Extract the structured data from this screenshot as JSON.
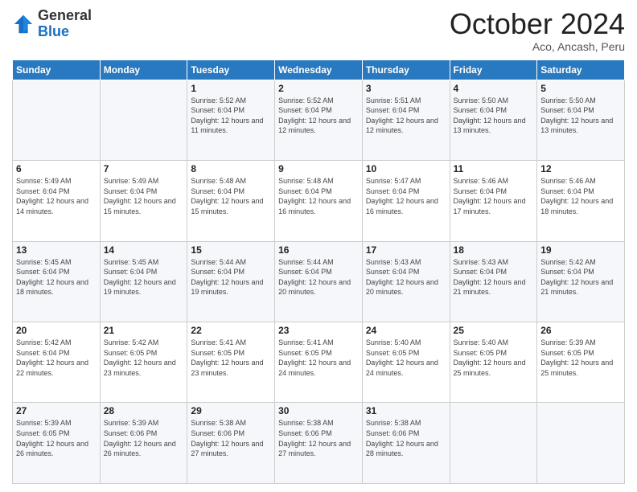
{
  "logo": {
    "general": "General",
    "blue": "Blue"
  },
  "header": {
    "month": "October 2024",
    "location": "Aco, Ancash, Peru"
  },
  "weekdays": [
    "Sunday",
    "Monday",
    "Tuesday",
    "Wednesday",
    "Thursday",
    "Friday",
    "Saturday"
  ],
  "weeks": [
    [
      null,
      null,
      {
        "day": 1,
        "sunrise": "5:52 AM",
        "sunset": "6:04 PM",
        "daylight": "12 hours and 11 minutes."
      },
      {
        "day": 2,
        "sunrise": "5:52 AM",
        "sunset": "6:04 PM",
        "daylight": "12 hours and 12 minutes."
      },
      {
        "day": 3,
        "sunrise": "5:51 AM",
        "sunset": "6:04 PM",
        "daylight": "12 hours and 12 minutes."
      },
      {
        "day": 4,
        "sunrise": "5:50 AM",
        "sunset": "6:04 PM",
        "daylight": "12 hours and 13 minutes."
      },
      {
        "day": 5,
        "sunrise": "5:50 AM",
        "sunset": "6:04 PM",
        "daylight": "12 hours and 13 minutes."
      }
    ],
    [
      {
        "day": 6,
        "sunrise": "5:49 AM",
        "sunset": "6:04 PM",
        "daylight": "12 hours and 14 minutes."
      },
      {
        "day": 7,
        "sunrise": "5:49 AM",
        "sunset": "6:04 PM",
        "daylight": "12 hours and 15 minutes."
      },
      {
        "day": 8,
        "sunrise": "5:48 AM",
        "sunset": "6:04 PM",
        "daylight": "12 hours and 15 minutes."
      },
      {
        "day": 9,
        "sunrise": "5:48 AM",
        "sunset": "6:04 PM",
        "daylight": "12 hours and 16 minutes."
      },
      {
        "day": 10,
        "sunrise": "5:47 AM",
        "sunset": "6:04 PM",
        "daylight": "12 hours and 16 minutes."
      },
      {
        "day": 11,
        "sunrise": "5:46 AM",
        "sunset": "6:04 PM",
        "daylight": "12 hours and 17 minutes."
      },
      {
        "day": 12,
        "sunrise": "5:46 AM",
        "sunset": "6:04 PM",
        "daylight": "12 hours and 18 minutes."
      }
    ],
    [
      {
        "day": 13,
        "sunrise": "5:45 AM",
        "sunset": "6:04 PM",
        "daylight": "12 hours and 18 minutes."
      },
      {
        "day": 14,
        "sunrise": "5:45 AM",
        "sunset": "6:04 PM",
        "daylight": "12 hours and 19 minutes."
      },
      {
        "day": 15,
        "sunrise": "5:44 AM",
        "sunset": "6:04 PM",
        "daylight": "12 hours and 19 minutes."
      },
      {
        "day": 16,
        "sunrise": "5:44 AM",
        "sunset": "6:04 PM",
        "daylight": "12 hours and 20 minutes."
      },
      {
        "day": 17,
        "sunrise": "5:43 AM",
        "sunset": "6:04 PM",
        "daylight": "12 hours and 20 minutes."
      },
      {
        "day": 18,
        "sunrise": "5:43 AM",
        "sunset": "6:04 PM",
        "daylight": "12 hours and 21 minutes."
      },
      {
        "day": 19,
        "sunrise": "5:42 AM",
        "sunset": "6:04 PM",
        "daylight": "12 hours and 21 minutes."
      }
    ],
    [
      {
        "day": 20,
        "sunrise": "5:42 AM",
        "sunset": "6:04 PM",
        "daylight": "12 hours and 22 minutes."
      },
      {
        "day": 21,
        "sunrise": "5:42 AM",
        "sunset": "6:05 PM",
        "daylight": "12 hours and 23 minutes."
      },
      {
        "day": 22,
        "sunrise": "5:41 AM",
        "sunset": "6:05 PM",
        "daylight": "12 hours and 23 minutes."
      },
      {
        "day": 23,
        "sunrise": "5:41 AM",
        "sunset": "6:05 PM",
        "daylight": "12 hours and 24 minutes."
      },
      {
        "day": 24,
        "sunrise": "5:40 AM",
        "sunset": "6:05 PM",
        "daylight": "12 hours and 24 minutes."
      },
      {
        "day": 25,
        "sunrise": "5:40 AM",
        "sunset": "6:05 PM",
        "daylight": "12 hours and 25 minutes."
      },
      {
        "day": 26,
        "sunrise": "5:39 AM",
        "sunset": "6:05 PM",
        "daylight": "12 hours and 25 minutes."
      }
    ],
    [
      {
        "day": 27,
        "sunrise": "5:39 AM",
        "sunset": "6:05 PM",
        "daylight": "12 hours and 26 minutes."
      },
      {
        "day": 28,
        "sunrise": "5:39 AM",
        "sunset": "6:06 PM",
        "daylight": "12 hours and 26 minutes."
      },
      {
        "day": 29,
        "sunrise": "5:38 AM",
        "sunset": "6:06 PM",
        "daylight": "12 hours and 27 minutes."
      },
      {
        "day": 30,
        "sunrise": "5:38 AM",
        "sunset": "6:06 PM",
        "daylight": "12 hours and 27 minutes."
      },
      {
        "day": 31,
        "sunrise": "5:38 AM",
        "sunset": "6:06 PM",
        "daylight": "12 hours and 28 minutes."
      },
      null,
      null
    ]
  ]
}
